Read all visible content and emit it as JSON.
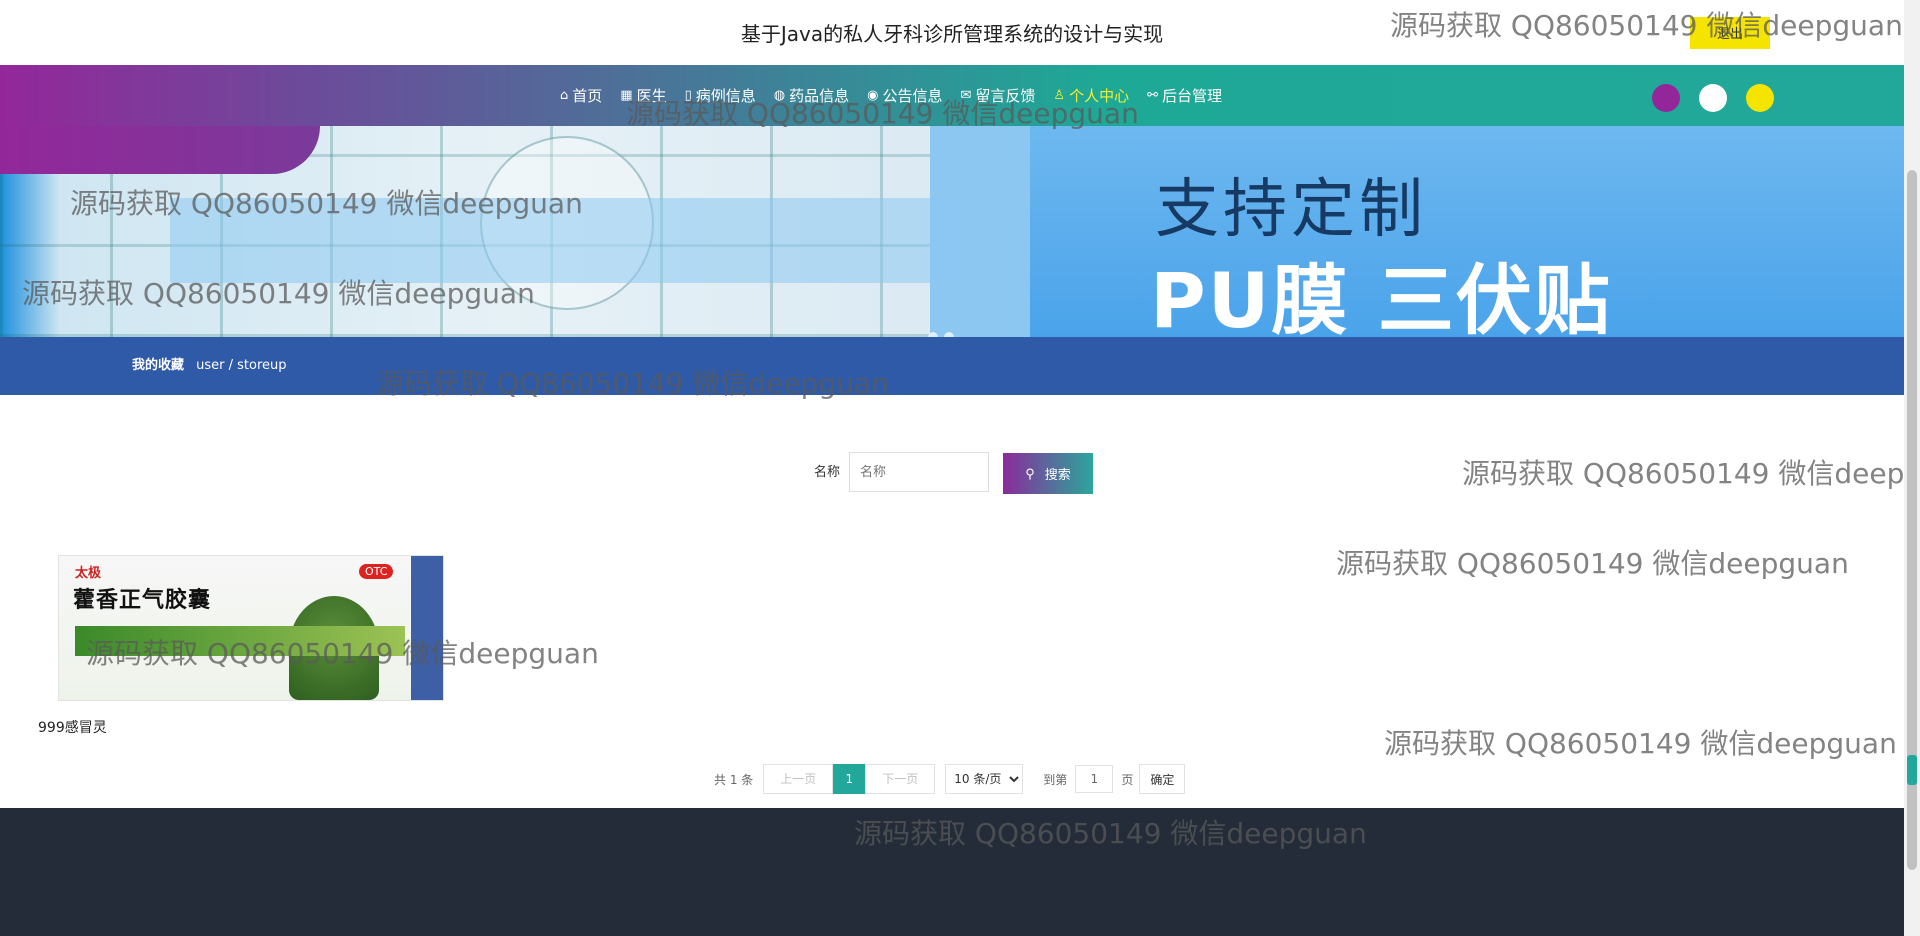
{
  "header": {
    "site_title": "基于Java的私人牙科诊所管理系统的设计与实现",
    "logout_label": "退出"
  },
  "nav": {
    "items": [
      {
        "icon": "home-icon",
        "label": "首页",
        "active": false
      },
      {
        "icon": "grid-icon",
        "label": "医生",
        "active": false
      },
      {
        "icon": "book-icon",
        "label": "病例信息",
        "active": false
      },
      {
        "icon": "medicine-icon",
        "label": "药品信息",
        "active": false
      },
      {
        "icon": "notice-icon",
        "label": "公告信息",
        "active": false
      },
      {
        "icon": "mail-icon",
        "label": "留言反馈",
        "active": false
      },
      {
        "icon": "user-icon",
        "label": "个人中心",
        "active": true
      },
      {
        "icon": "link-icon",
        "label": "后台管理",
        "active": false
      }
    ],
    "active_color": "#f5f032",
    "theme_colors": [
      "#93279a",
      "#ffffff",
      "#f5e400"
    ]
  },
  "banner": {
    "headline": "支持定制",
    "subline": "PU膜 三伏贴",
    "slide_count": 2
  },
  "breadcrumb": {
    "title": "我的收藏",
    "path": "user / storeup"
  },
  "search": {
    "label": "名称",
    "placeholder": "名称",
    "value": "",
    "button_label": "搜索"
  },
  "items": [
    {
      "name": "999感冒灵",
      "image": {
        "brand": "太极",
        "otc": "OTC",
        "product": "藿香正气胶囊"
      }
    }
  ],
  "pagination": {
    "total_label": "共 1 条",
    "prev_label": "上一页",
    "current_page": "1",
    "next_label": "下一页",
    "page_size_selected": "10 条/页",
    "goto_label": "到第",
    "goto_value": "1",
    "unit_label": "页",
    "confirm_label": "确定"
  },
  "watermark": {
    "text": "源码获取 QQ86050149 微信deepguan"
  },
  "colors": {
    "accent_teal": "#22a89a",
    "accent_purple": "#93279a",
    "crumb_bar": "#2f5aa7",
    "footer": "#232c38",
    "logout": "#f5e400"
  }
}
